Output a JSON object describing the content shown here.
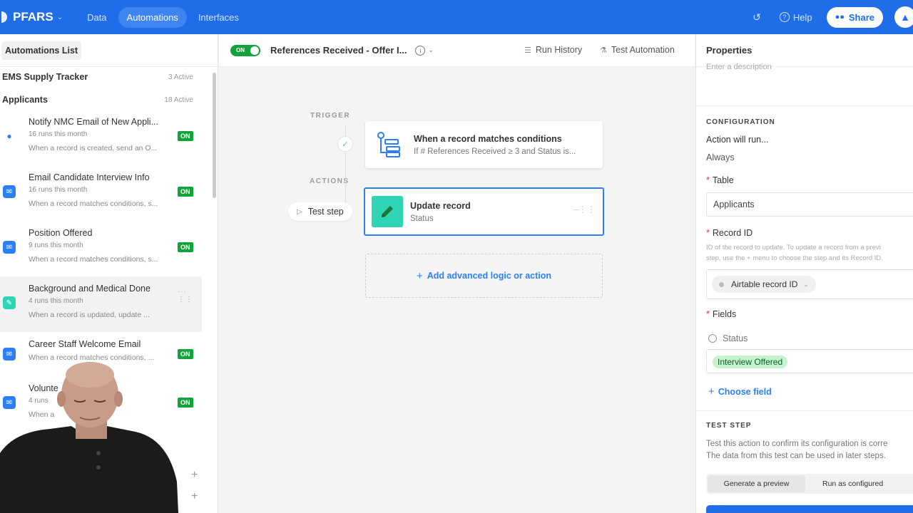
{
  "topbar": {
    "brand": "PFARS",
    "nav": [
      "Data",
      "Automations",
      "Interfaces"
    ],
    "active_nav": "Automations",
    "help_label": "Help",
    "share_label": "Share",
    "bell_icon": "bell-icon",
    "history_icon": "history-icon",
    "colors": {
      "bar": "#1f6de8",
      "active_pill": "#3f85f2"
    }
  },
  "sidebar": {
    "title": "Automations List",
    "groups": [
      {
        "name": "EMS Supply Tracker",
        "count": "3 Active"
      },
      {
        "name": "Applicants",
        "count": "18 Active"
      }
    ],
    "items": [
      {
        "name": "Notify NMC Email of New Appli...",
        "runs": "16 runs this month",
        "desc": "When a record is created, send an O...",
        "icon": "bolt-icon",
        "status": "ON"
      },
      {
        "name": "Email Candidate Interview Info",
        "runs": "16 runs this month",
        "desc": "When a record matches conditions, s...",
        "icon": "mail-icon",
        "status": "ON"
      },
      {
        "name": "Position Offered",
        "runs": "9 runs this month",
        "desc": "When a record matches conditions, s...",
        "icon": "mail-icon",
        "status": "ON"
      },
      {
        "name": "Background and Medical Done",
        "runs": "4 runs this month",
        "desc": "When a record is updated, update ...",
        "icon": "pencil-icon",
        "status": ""
      },
      {
        "name": "Career Staff Welcome Email",
        "runs": "",
        "desc": "When a record matches conditions, ...",
        "icon": "mail-icon",
        "status": "ON"
      },
      {
        "name": "Volunte",
        "runs": "4 runs",
        "desc": "When a",
        "icon": "mail-icon",
        "status": "ON"
      }
    ],
    "on_color": "#11a33a"
  },
  "canvas": {
    "toggle_label": "ON",
    "automation_title": "References Received - Offer I...",
    "run_history": "Run History",
    "test_automation": "Test Automation",
    "trigger_label": "TRIGGER",
    "actions_label": "ACTIONS",
    "test_step": "Test step",
    "trigger_card": {
      "title": "When a record matches conditions",
      "subtitle": "If # References Received ≥ 3 and Status is..."
    },
    "action_card": {
      "title": "Update record",
      "subtitle": "Status"
    },
    "add_logic": "Add advanced logic or action",
    "accent": "#2d7ff9"
  },
  "properties": {
    "header": "Properties",
    "description_placeholder": "Enter a description",
    "configuration_label": "CONFIGURATION",
    "action_will_run": "Action will run...",
    "always": "Always",
    "table_label": "Table",
    "table_value": "Applicants",
    "record_id_label": "Record ID",
    "record_id_help_1": "ID of the record to update. To update a record from a previ",
    "record_id_help_2": "step, use the + menu to choose the step and its Record ID.",
    "record_id_pill": "Airtable record ID",
    "fields_label": "Fields",
    "status_field": "Status",
    "status_value": "Interview Offered",
    "choose_field": "Choose field",
    "test_step_label": "TEST STEP",
    "test_desc_1": "Test this action to confirm its configuration is corre",
    "test_desc_2": "The data from this test can be used in later steps.",
    "generate_preview": "Generate a preview",
    "run_as_configured": "Run as configured",
    "status_tag_color": "#c5f2cf"
  }
}
